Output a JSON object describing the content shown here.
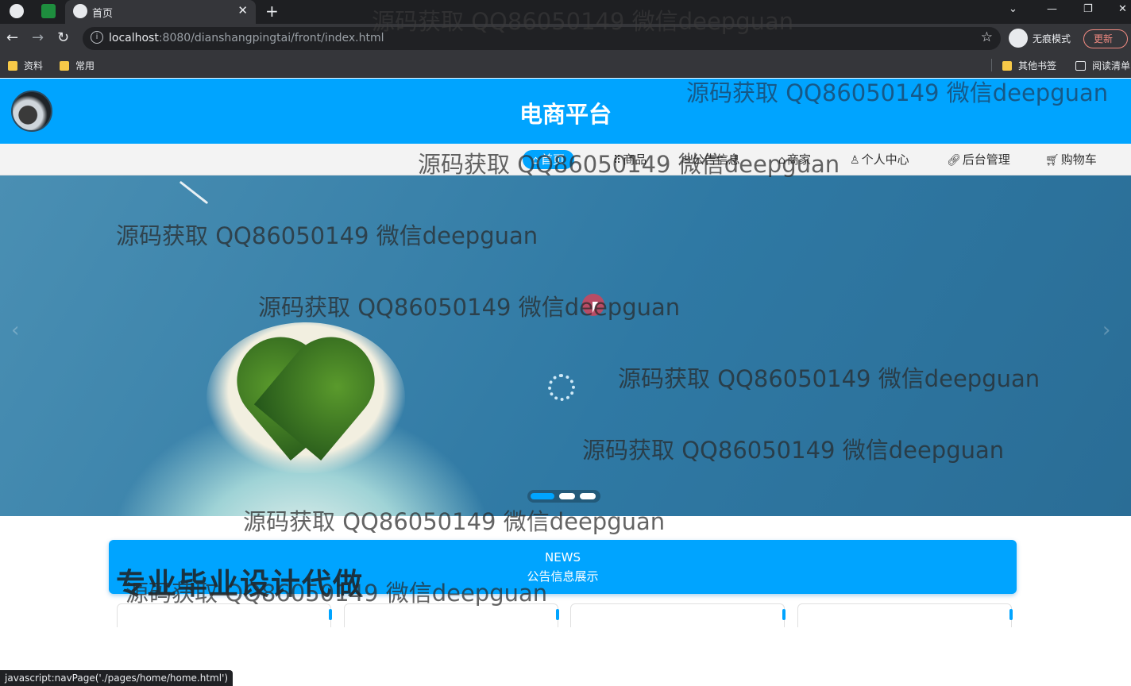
{
  "browser": {
    "tab_title": "首页",
    "url_host": "localhost",
    "url_rest": ":8080/dianshangpingtai/front/index.html",
    "incognito_label": "无痕模式",
    "update_label": "更新",
    "bookmarks": [
      "资料",
      "常用"
    ],
    "other_bookmarks": "其他书签",
    "reading_list": "阅读清单",
    "status_text": "javascript:navPage('./pages/home/home.html')"
  },
  "site": {
    "title": "电商平台",
    "menu": [
      {
        "label": "首页",
        "icon": "home-icon",
        "active": true
      },
      {
        "label": "商品",
        "icon": "grid-icon",
        "active": false
      },
      {
        "label": "公告信息",
        "icon": "notice-icon",
        "active": false
      },
      {
        "label": "商家",
        "icon": "shop-icon",
        "active": false
      },
      {
        "label": "个人中心",
        "icon": "user-icon",
        "active": false
      },
      {
        "label": "后台管理",
        "icon": "link-icon",
        "active": false
      },
      {
        "label": "购物车",
        "icon": "cart-icon",
        "active": false
      }
    ],
    "carousel": {
      "slides": 3,
      "active_index": 0
    },
    "news": {
      "en": "NEWS",
      "cn": "公告信息展示"
    },
    "promo_text": "专业毕业设计代做"
  },
  "watermark": "源码获取 QQ86050149 微信deepguan",
  "colors": {
    "brand": "#00a4ff",
    "menu_bg": "#f3f3f3"
  }
}
